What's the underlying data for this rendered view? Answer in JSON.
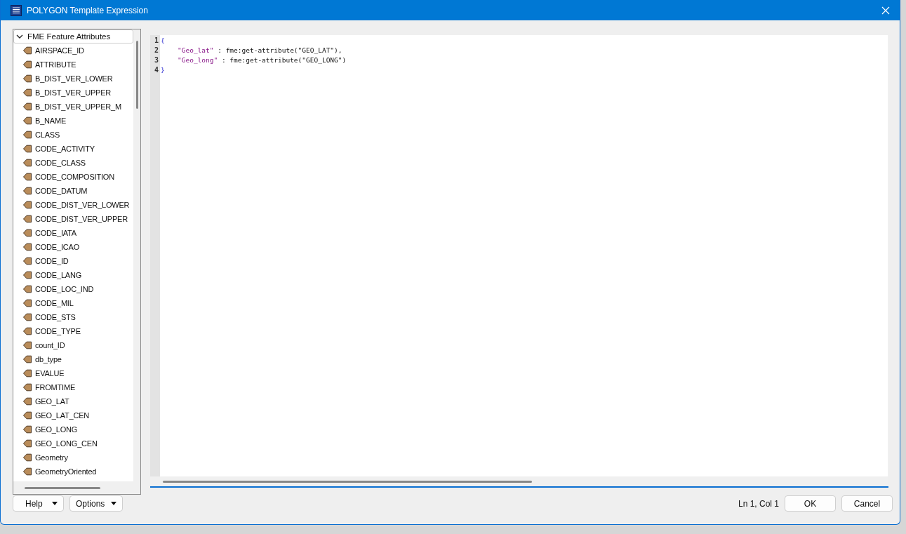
{
  "window": {
    "title": "POLYGON Template Expression"
  },
  "tree": {
    "label": "FME Feature Attributes",
    "expanded": true,
    "children": [
      {
        "label": "AIRSPACE_ID"
      },
      {
        "label": "ATTRIBUTE"
      },
      {
        "label": "B_DIST_VER_LOWER"
      },
      {
        "label": "B_DIST_VER_UPPER"
      },
      {
        "label": "B_DIST_VER_UPPER_M"
      },
      {
        "label": "B_NAME"
      },
      {
        "label": "CLASS"
      },
      {
        "label": "CODE_ACTIVITY"
      },
      {
        "label": "CODE_CLASS"
      },
      {
        "label": "CODE_COMPOSITION"
      },
      {
        "label": "CODE_DATUM"
      },
      {
        "label": "CODE_DIST_VER_LOWER"
      },
      {
        "label": "CODE_DIST_VER_UPPER"
      },
      {
        "label": "CODE_IATA"
      },
      {
        "label": "CODE_ICAO"
      },
      {
        "label": "CODE_ID"
      },
      {
        "label": "CODE_LANG"
      },
      {
        "label": "CODE_LOC_IND"
      },
      {
        "label": "CODE_MIL"
      },
      {
        "label": "CODE_STS"
      },
      {
        "label": "CODE_TYPE"
      },
      {
        "label": "count_ID"
      },
      {
        "label": "db_type"
      },
      {
        "label": "EVALUE"
      },
      {
        "label": "FROMTIME"
      },
      {
        "label": "GEO_LAT"
      },
      {
        "label": "GEO_LAT_CEN"
      },
      {
        "label": "GEO_LONG"
      },
      {
        "label": "GEO_LONG_CEN"
      },
      {
        "label": "Geometry"
      },
      {
        "label": "GeometryOriented"
      }
    ]
  },
  "editor": {
    "lines": [
      {
        "number": "1",
        "indent": false,
        "tokens": [
          {
            "kind": "brace",
            "text": "{"
          }
        ]
      },
      {
        "number": "2",
        "indent": true,
        "tokens": [
          {
            "kind": "string",
            "text": "\"Geo_lat\""
          },
          {
            "kind": "plain",
            "text": " : fme:get-attribute(\"GEO_LAT\"),"
          }
        ]
      },
      {
        "number": "3",
        "indent": true,
        "tokens": [
          {
            "kind": "string",
            "text": "\"Geo_long\""
          },
          {
            "kind": "plain",
            "text": " : fme:get-attribute(\"GEO_LONG\")"
          }
        ]
      },
      {
        "number": "4",
        "indent": false,
        "tokens": [
          {
            "kind": "brace",
            "text": "}"
          }
        ]
      }
    ]
  },
  "footer": {
    "help": "Help",
    "options": "Options",
    "status": "Ln 1, Col 1",
    "ok": "OK",
    "cancel": "Cancel"
  }
}
